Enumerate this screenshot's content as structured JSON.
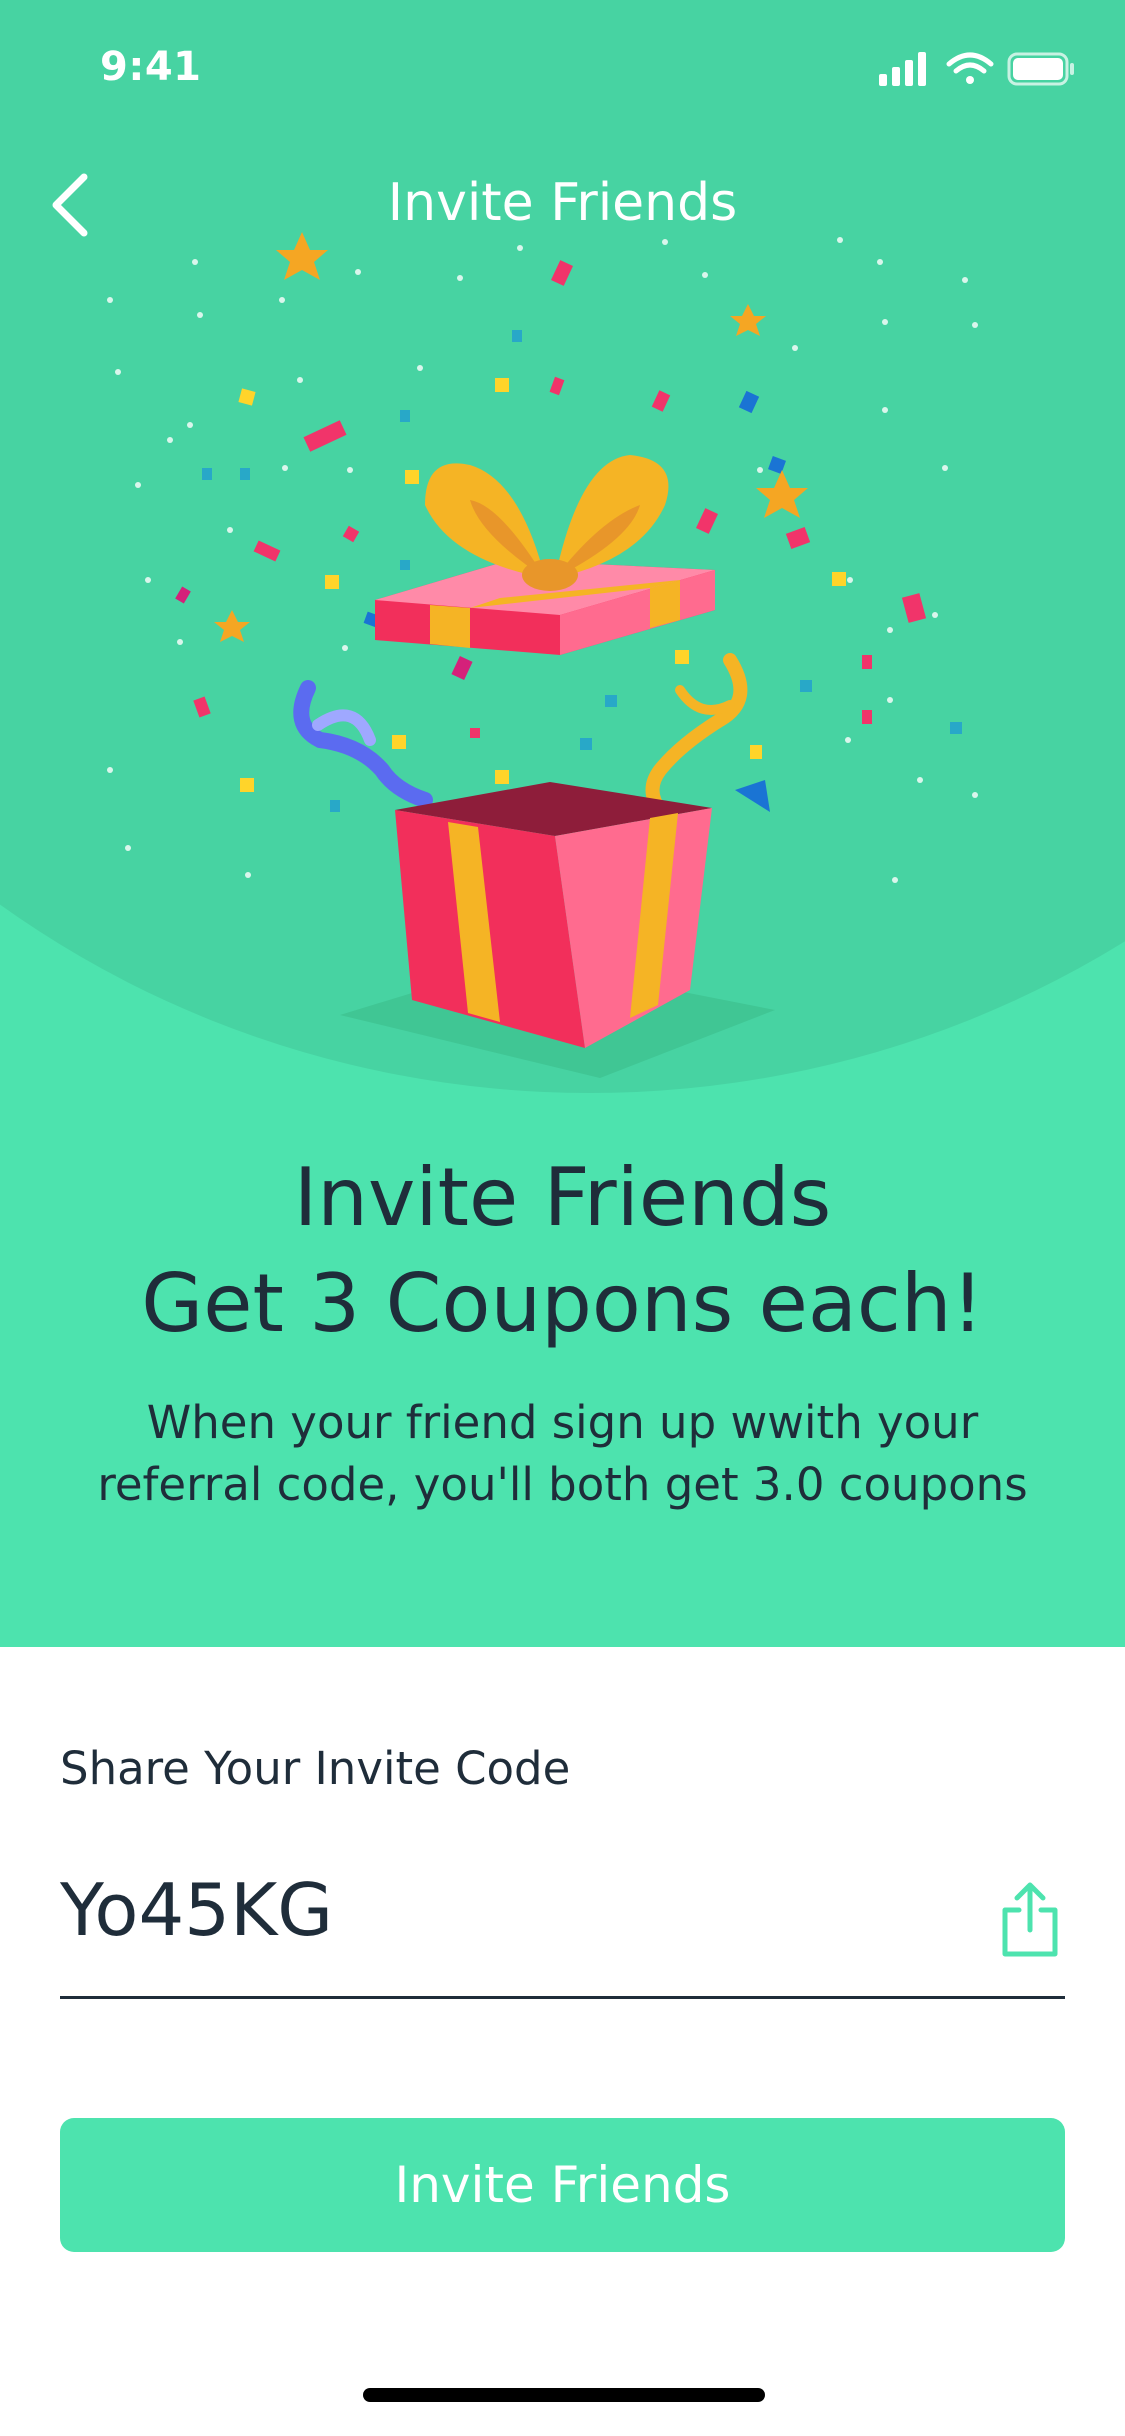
{
  "colors": {
    "accent": "#4de3ae",
    "hero_circle": "#47d3a2",
    "text_dark": "#1f2d3a",
    "white": "#ffffff"
  },
  "status_bar": {
    "time": "9:41",
    "icons": [
      "signal-icon",
      "wifi-icon",
      "battery-icon"
    ]
  },
  "nav": {
    "back_icon": "chevron-left-icon",
    "title": "Invite Friends"
  },
  "hero": {
    "headline_line1": "Invite Friends",
    "headline_line2": "Get 3 Coupons each!",
    "subline_line1": "When your friend sign up wwith your",
    "subline_line2": "referral code, you'll both get 3.0 coupons",
    "illustration": "gift-box-confetti-illustration"
  },
  "share": {
    "label": "Share Your Invite Code",
    "code": "Yo45KG",
    "share_icon": "share-icon"
  },
  "cta": {
    "label": "Invite Friends"
  }
}
